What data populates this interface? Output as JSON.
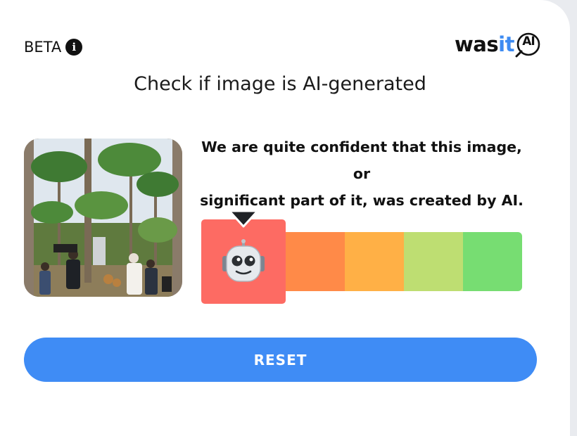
{
  "header": {
    "beta_label": "BETA",
    "info_icon": "info-icon",
    "logo": {
      "part1": "was",
      "part2": "it",
      "part3": "AI"
    }
  },
  "title": "Check if image is AI-generated",
  "result": {
    "line1": "We are quite confident that this image, or",
    "line2": "significant part of it, was created by AI.",
    "scale_colors": [
      "#fd6b63",
      "#ff8a48",
      "#ffb046",
      "#bede72",
      "#77dd72"
    ],
    "selected_index": 0,
    "selected_icon": "robot-face-icon"
  },
  "actions": {
    "reset_label": "RESET"
  },
  "colors": {
    "accent": "#3f8cf5",
    "logo_accent": "#3d8bf2"
  }
}
